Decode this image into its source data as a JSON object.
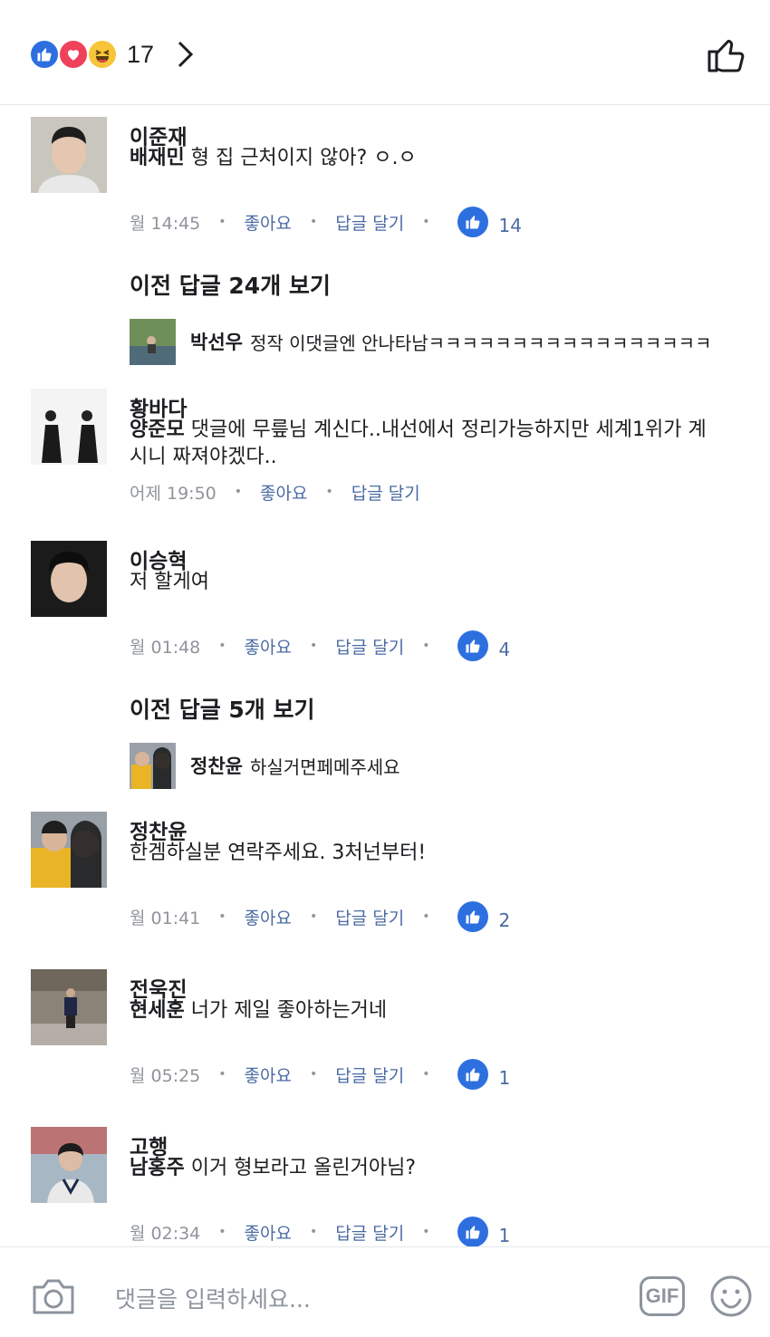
{
  "header": {
    "reactions": [
      "like-icon",
      "love-icon",
      "haha-icon"
    ],
    "reaction_count": "17",
    "chevron": "chevron-right-icon",
    "like_button_icon": "thumbs-up-outline-icon"
  },
  "labels": {
    "like": "좋아요",
    "reply": "답글 달기",
    "dot": "•"
  },
  "comments": [
    {
      "author": "이준재",
      "mention": "배재민",
      "text": " 형 집 근처이지 않아? ㅇ.ㅇ",
      "time": "월 14:45",
      "likes": "14"
    },
    {
      "author": "황바다",
      "mention": "양준모",
      "text": " 댓글에 무릎님 계신다..내선에서 정리가능하지만 세계1위가 계시니 짜져야겠다..",
      "time": "어제 19:50",
      "likes": ""
    },
    {
      "author": "이승혁",
      "mention": "",
      "text": "저 할게여",
      "time": "월 01:48",
      "likes": "4"
    },
    {
      "author": "정찬윤",
      "mention": "",
      "text": "한겜하실분 연락주세요. 3처넌부터!",
      "time": "월 01:41",
      "likes": "2"
    },
    {
      "author": "전욱진",
      "mention": "현세훈",
      "text": " 너가 제일 좋아하는거네",
      "time": "월 05:25",
      "likes": "1"
    },
    {
      "author": "고행",
      "mention": "남홍주",
      "text": " 이거 형보라고 올린거아님?",
      "time": "월 02:34",
      "likes": "1"
    }
  ],
  "reply_groups": [
    {
      "view_previous": "이전 답글 24개 보기",
      "reply_author": "박선우",
      "reply_text": "정작 이댓글엔 안나타남ㅋㅋㅋㅋㅋㅋㅋㅋㅋㅋㅋㅋㅋㅋㅋㅋㅋ"
    },
    {
      "view_previous": "이전 답글 5개 보기",
      "reply_author": "정찬윤",
      "reply_text": "하실거면페메주세요"
    }
  ],
  "input": {
    "placeholder": "댓글을 입력하세요...",
    "camera_icon": "camera-icon",
    "gif_label": "GIF",
    "emoji_icon": "smiley-icon"
  },
  "colors": {
    "like_blue": "#2e6fe0",
    "love_red": "#f0415b",
    "haha_yellow": "#f7c53a",
    "link_blue": "#4b6ba3",
    "meta_gray": "#90949c"
  }
}
